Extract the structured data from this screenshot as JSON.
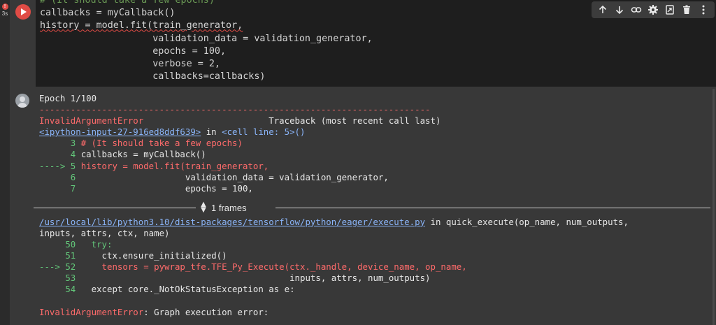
{
  "cell": {
    "exec_time": "3s",
    "error_indicator": "!",
    "code_lines": [
      {
        "text": "# (It should take a few epochs)",
        "kind": "comment"
      },
      {
        "text": "callbacks = myCallback()",
        "kind": "code"
      },
      {
        "text": "history = model.fit(train_generator,",
        "kind": "code"
      },
      {
        "text": "                    validation_data = validation_generator,",
        "kind": "code"
      },
      {
        "text": "                    epochs = 100,",
        "kind": "code"
      },
      {
        "text": "                    verbose = 2,",
        "kind": "code"
      },
      {
        "text": "                    callbacks=callbacks)",
        "kind": "code"
      }
    ]
  },
  "toolbar": {
    "icons": [
      "arrow-up-icon",
      "arrow-down-icon",
      "link-icon",
      "gear-icon",
      "mirror-cell-icon",
      "delete-icon",
      "more-vert-icon"
    ]
  },
  "output": {
    "epoch": "Epoch 1/100",
    "dashes": "---------------------------------------------------------------------------",
    "error_type": "InvalidArgumentError",
    "traceback_header": "                        Traceback (most recent call last)",
    "cell_link": "<ipython-input-27-916ed8ddf639>",
    "cell_loc_in": " in ",
    "cell_loc": "<cell line: 5>()",
    "frame1": [
      {
        "marker": "      ",
        "num": "3",
        "text": " # (It should take a few epochs)",
        "style": "red"
      },
      {
        "marker": "      ",
        "num": "4",
        "text": " callbacks = myCallback()",
        "style": "plain"
      },
      {
        "marker": "----> ",
        "num": "5",
        "text": " history = model.fit(train_generator,",
        "style": "red"
      },
      {
        "marker": "      ",
        "num": "6",
        "text": "                     validation_data = validation_generator,",
        "style": "plain"
      },
      {
        "marker": "      ",
        "num": "7",
        "text": "                     epochs = 100,",
        "style": "plain"
      }
    ],
    "frames_label": "1 frames",
    "path_link": "/usr/local/lib/python3.10/dist-packages/tensorflow/python/eager/execute.py",
    "path_in": " in quick_execute(op_name, num_outputs,",
    "path_cont": "inputs, attrs, ctx, name)",
    "frame2": [
      {
        "marker": "     ",
        "num": "50",
        "text": "   try:",
        "style": "grn"
      },
      {
        "marker": "     ",
        "num": "51",
        "text": "     ctx.ensure_initialized()",
        "style": "plain"
      },
      {
        "marker": "---> ",
        "num": "52",
        "text": "     tensors = pywrap_tfe.TFE_Py_Execute(ctx._handle, device_name, op_name,",
        "style": "red"
      },
      {
        "marker": "     ",
        "num": "53",
        "text": "                                         inputs, attrs, num_outputs)",
        "style": "plain"
      },
      {
        "marker": "     ",
        "num": "54",
        "text": "   except core._NotOkStatusException as e:",
        "style": "plain"
      }
    ],
    "final_error_type": "InvalidArgumentError",
    "final_error_msg": ": Graph execution error:"
  },
  "colors": {
    "error_red": "#ff6b6b",
    "line_number_green": "#63c77a",
    "link_blue": "#8ab4f8",
    "run_button_red": "#e04b45"
  }
}
